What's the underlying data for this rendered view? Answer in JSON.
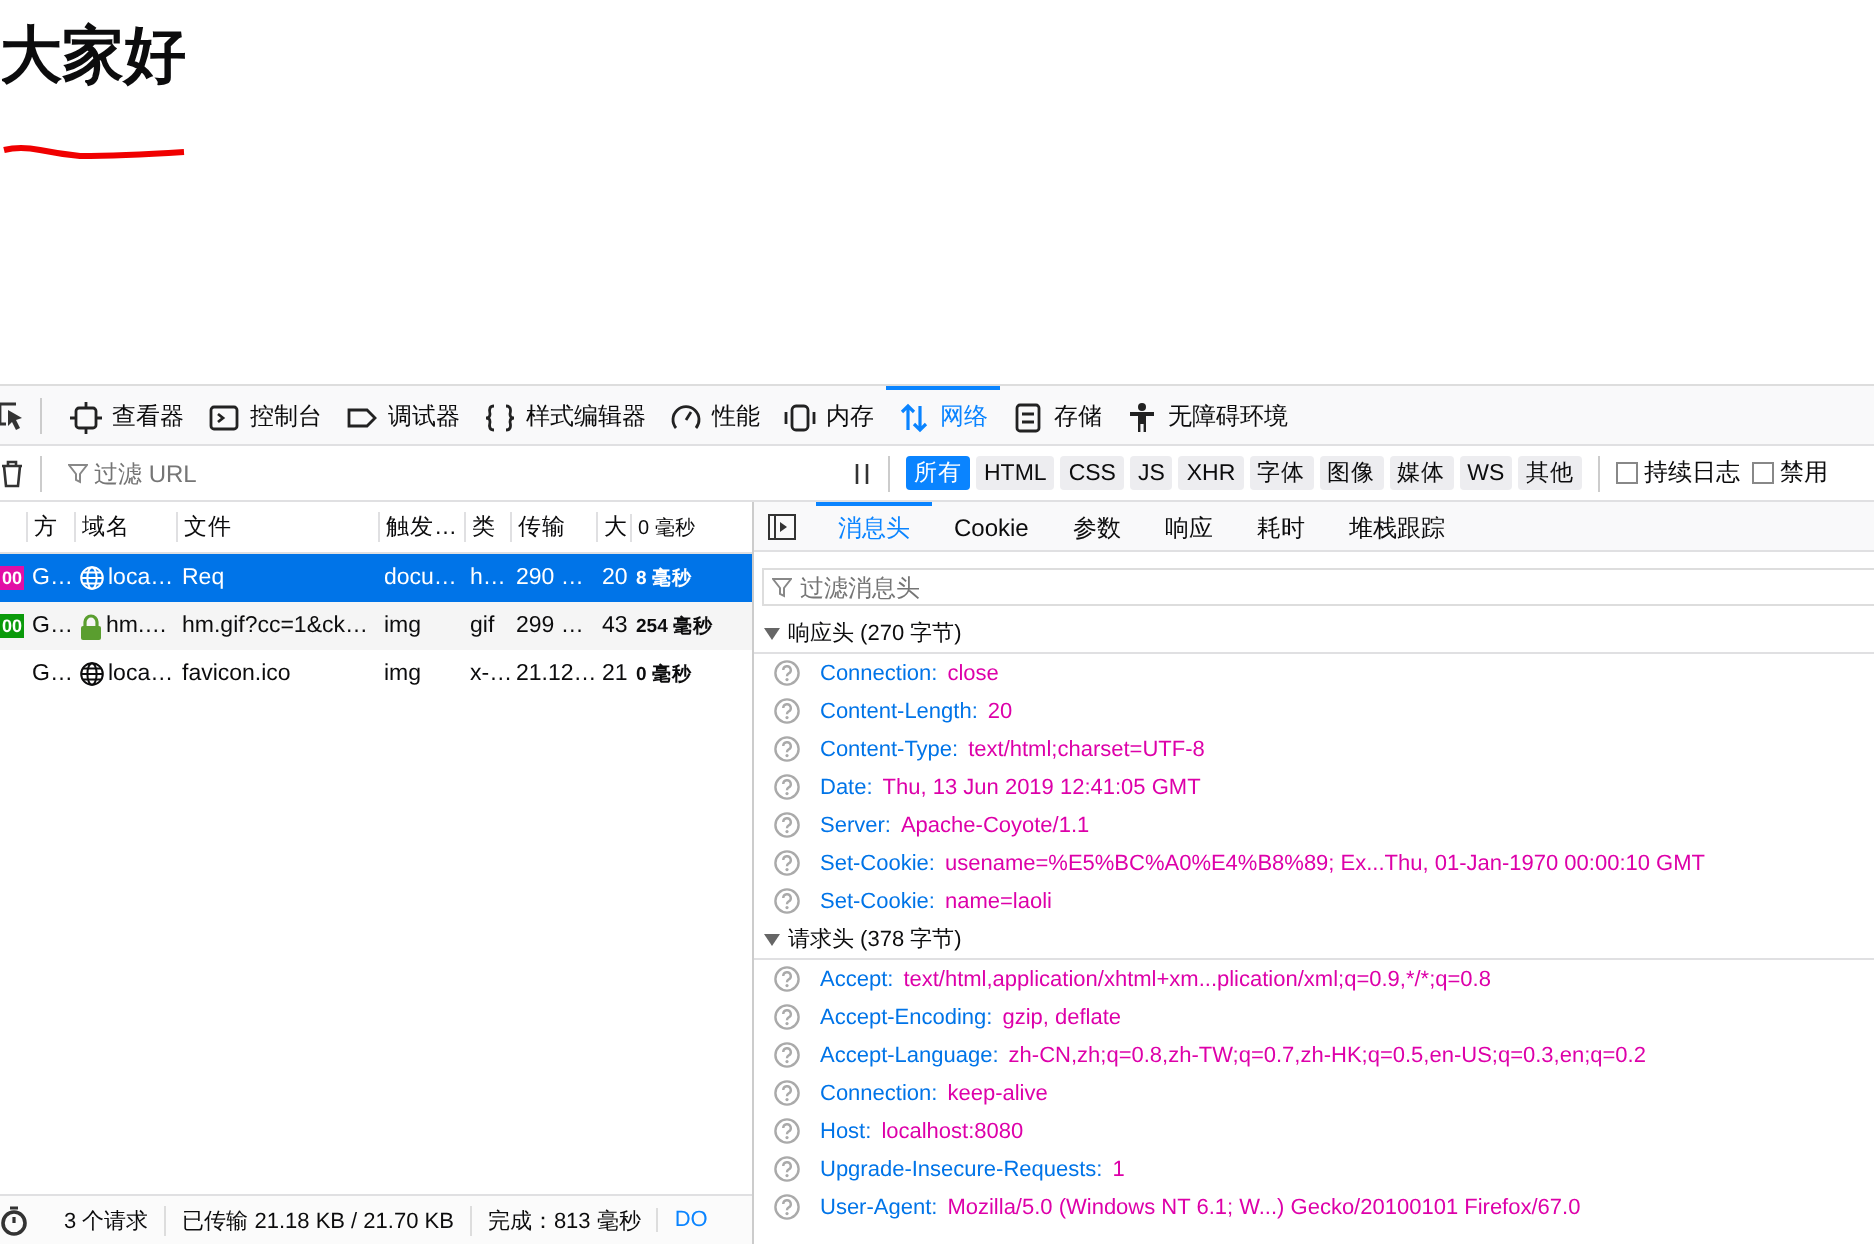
{
  "page": {
    "heading": "大家好"
  },
  "devtools": {
    "tools": [
      {
        "label": "查看器",
        "selected": false
      },
      {
        "label": "控制台",
        "selected": false
      },
      {
        "label": "调试器",
        "selected": false
      },
      {
        "label": "样式编辑器",
        "selected": false
      },
      {
        "label": "性能",
        "selected": false
      },
      {
        "label": "内存",
        "selected": false
      },
      {
        "label": "网络",
        "selected": true
      },
      {
        "label": "存储",
        "selected": false
      },
      {
        "label": "无障碍环境",
        "selected": false
      }
    ],
    "filter": {
      "placeholder": "过滤 URL"
    },
    "type_filters": [
      {
        "label": "所有",
        "selected": true
      },
      {
        "label": "HTML",
        "selected": false
      },
      {
        "label": "CSS",
        "selected": false
      },
      {
        "label": "JS",
        "selected": false
      },
      {
        "label": "XHR",
        "selected": false
      },
      {
        "label": "字体",
        "selected": false
      },
      {
        "label": "图像",
        "selected": false
      },
      {
        "label": "媒体",
        "selected": false
      },
      {
        "label": "WS",
        "selected": false
      },
      {
        "label": "其他",
        "selected": false
      }
    ],
    "options": [
      {
        "label": "持续日志",
        "checked": false
      },
      {
        "label": "禁用",
        "checked": false
      }
    ],
    "requests": {
      "columns": [
        "方",
        "域名",
        "文件",
        "触发…",
        "类",
        "传输",
        "大",
        "0 毫秒"
      ],
      "rows": [
        {
          "status": "00",
          "color": "#e20ea6",
          "method": "G…",
          "secure": false,
          "domain": "loca…",
          "file": "Req",
          "cause": "docu…",
          "type": "h…",
          "transferred": "290 …",
          "size": "20",
          "time": "8 毫秒",
          "selected": true
        },
        {
          "status": "00",
          "color": "#0a9a0a",
          "method": "G…",
          "secure": true,
          "domain": "hm.…",
          "file": "hm.gif?cc=1&ck…",
          "cause": "img",
          "type": "gif",
          "transferred": "299 …",
          "size": "43",
          "time": "254 毫秒",
          "selected": false
        },
        {
          "method": "G…",
          "secure": false,
          "domain": "loca…",
          "file": "favicon.ico",
          "cause": "img",
          "type": "x-…",
          "transferred": "21.12…",
          "size": "21",
          "time": "0 毫秒",
          "selected": false
        }
      ]
    },
    "status_bar": [
      {
        "text": "3 个请求",
        "kind": "text"
      },
      {
        "text": "已传输 21.18 KB / 21.70 KB",
        "kind": "text"
      },
      {
        "text": "完成：813 毫秒",
        "kind": "text"
      },
      {
        "text": "DO",
        "kind": "link"
      }
    ],
    "detail_tabs": [
      {
        "label": "消息头",
        "selected": true
      },
      {
        "label": "Cookie",
        "selected": false
      },
      {
        "label": "参数",
        "selected": false
      },
      {
        "label": "响应",
        "selected": false
      },
      {
        "label": "耗时",
        "selected": false
      },
      {
        "label": "堆栈跟踪",
        "selected": false
      }
    ],
    "detail_filter": {
      "placeholder": "过滤消息头"
    },
    "sections": [
      {
        "title": "响应头 (270 字节)",
        "expanded": true,
        "headers": [
          {
            "name": "Connection:",
            "value": "close"
          },
          {
            "name": "Content-Length:",
            "value": "20"
          },
          {
            "name": "Content-Type:",
            "value": "text/html;charset=UTF-8"
          },
          {
            "name": "Date:",
            "value": "Thu, 13 Jun 2019 12:41:05 GMT"
          },
          {
            "name": "Server:",
            "value": "Apache-Coyote/1.1"
          },
          {
            "name": "Set-Cookie:",
            "value": "usename=%E5%BC%A0%E4%B8%89; Ex...Thu, 01-Jan-1970 00:00:10 GMT"
          },
          {
            "name": "Set-Cookie:",
            "value": "name=laoli"
          }
        ]
      },
      {
        "title": "请求头 (378 字节)",
        "expanded": true,
        "headers": [
          {
            "name": "Accept:",
            "value": "text/html,application/xhtml+xm...plication/xml;q=0.9,*/*;q=0.8"
          },
          {
            "name": "Accept-Encoding:",
            "value": "gzip, deflate"
          },
          {
            "name": "Accept-Language:",
            "value": "zh-CN,zh;q=0.8,zh-TW;q=0.7,zh-HK;q=0.5,en-US;q=0.3,en;q=0.2"
          },
          {
            "name": "Connection:",
            "value": "keep-alive"
          },
          {
            "name": "Host:",
            "value": "localhost:8080"
          },
          {
            "name": "Upgrade-Insecure-Requests:",
            "value": "1"
          },
          {
            "name": "User-Agent:",
            "value": "Mozilla/5.0 (Windows NT 6.1; W...) Gecko/20100101 Firefox/67.0"
          }
        ]
      }
    ]
  }
}
